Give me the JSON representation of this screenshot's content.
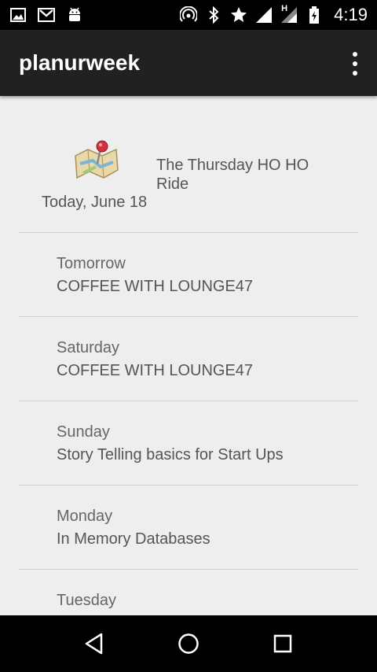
{
  "status_bar": {
    "time": "4:19",
    "icons_left": [
      "image-icon",
      "gmail-icon",
      "android-icon"
    ],
    "icons_right": [
      "hotspot-icon",
      "bluetooth-icon",
      "star-icon",
      "signal-icon",
      "signal-h-icon",
      "battery-icon"
    ],
    "network_type": "H"
  },
  "app_bar": {
    "title": "planurweek",
    "menu_icon": "overflow-menu-icon"
  },
  "today": {
    "icon": "map-pin-icon",
    "date": "Today, June 18",
    "event": "The Thursday HO HO Ride"
  },
  "days": [
    {
      "label": "Tomorrow",
      "event": "COFFEE WITH LOUNGE47"
    },
    {
      "label": "Saturday",
      "event": "COFFEE WITH LOUNGE47"
    },
    {
      "label": "Sunday",
      "event": "Story Telling basics for Start Ups"
    },
    {
      "label": "Monday",
      "event": "In Memory Databases"
    },
    {
      "label": "Tuesday",
      "event": ""
    }
  ],
  "nav_bar": {
    "back_icon": "back-icon",
    "home_icon": "home-icon",
    "recents_icon": "recents-icon"
  }
}
